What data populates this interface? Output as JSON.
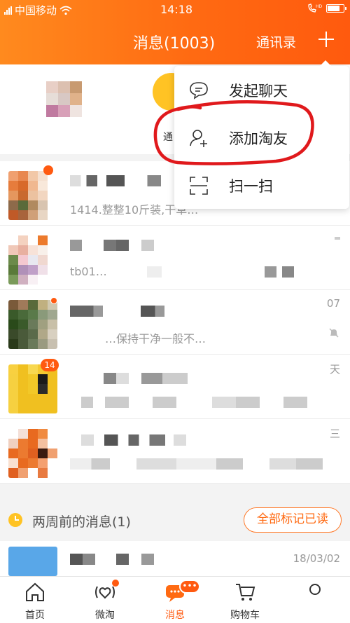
{
  "status": {
    "carrier": "中国移动",
    "time": "14:18",
    "hd": "HD"
  },
  "header": {
    "title": "消息(1003)",
    "contacts": "通讯录"
  },
  "quick": {
    "label": "通"
  },
  "popup": {
    "items": [
      {
        "label": "发起聊天",
        "icon": "chat-bubble-icon"
      },
      {
        "label": "添加淘友",
        "icon": "add-friend-icon"
      },
      {
        "label": "扫一扫",
        "icon": "scan-icon"
      }
    ]
  },
  "list": {
    "rows": [
      {
        "time": "",
        "preview": "1414.整整10斤装,干草…",
        "badge": ""
      },
      {
        "time": "",
        "preview": "tb01…",
        "badge": ""
      },
      {
        "time": "07",
        "preview": "…保持干净一般不…",
        "badge": ""
      },
      {
        "time": "天",
        "preview": "",
        "badge": "14"
      },
      {
        "time": "三",
        "preview": "",
        "badge": ""
      }
    ]
  },
  "section": {
    "label": "两周前的消息(1)",
    "mark_all": "全部标记已读"
  },
  "old_row": {
    "time": "18/03/02"
  },
  "nav": {
    "items": [
      {
        "label": "首页",
        "icon": "home-icon"
      },
      {
        "label": "微淘",
        "icon": "heart-waves-icon"
      },
      {
        "label": "消息",
        "icon": "message-icon"
      },
      {
        "label": "购物车",
        "icon": "cart-icon"
      },
      {
        "label": "",
        "icon": "user-icon"
      }
    ],
    "active_index": 2
  },
  "colors": {
    "brand": "#ff6a12",
    "accent_yellow": "#ffc324",
    "annotation": "#e0191c"
  }
}
